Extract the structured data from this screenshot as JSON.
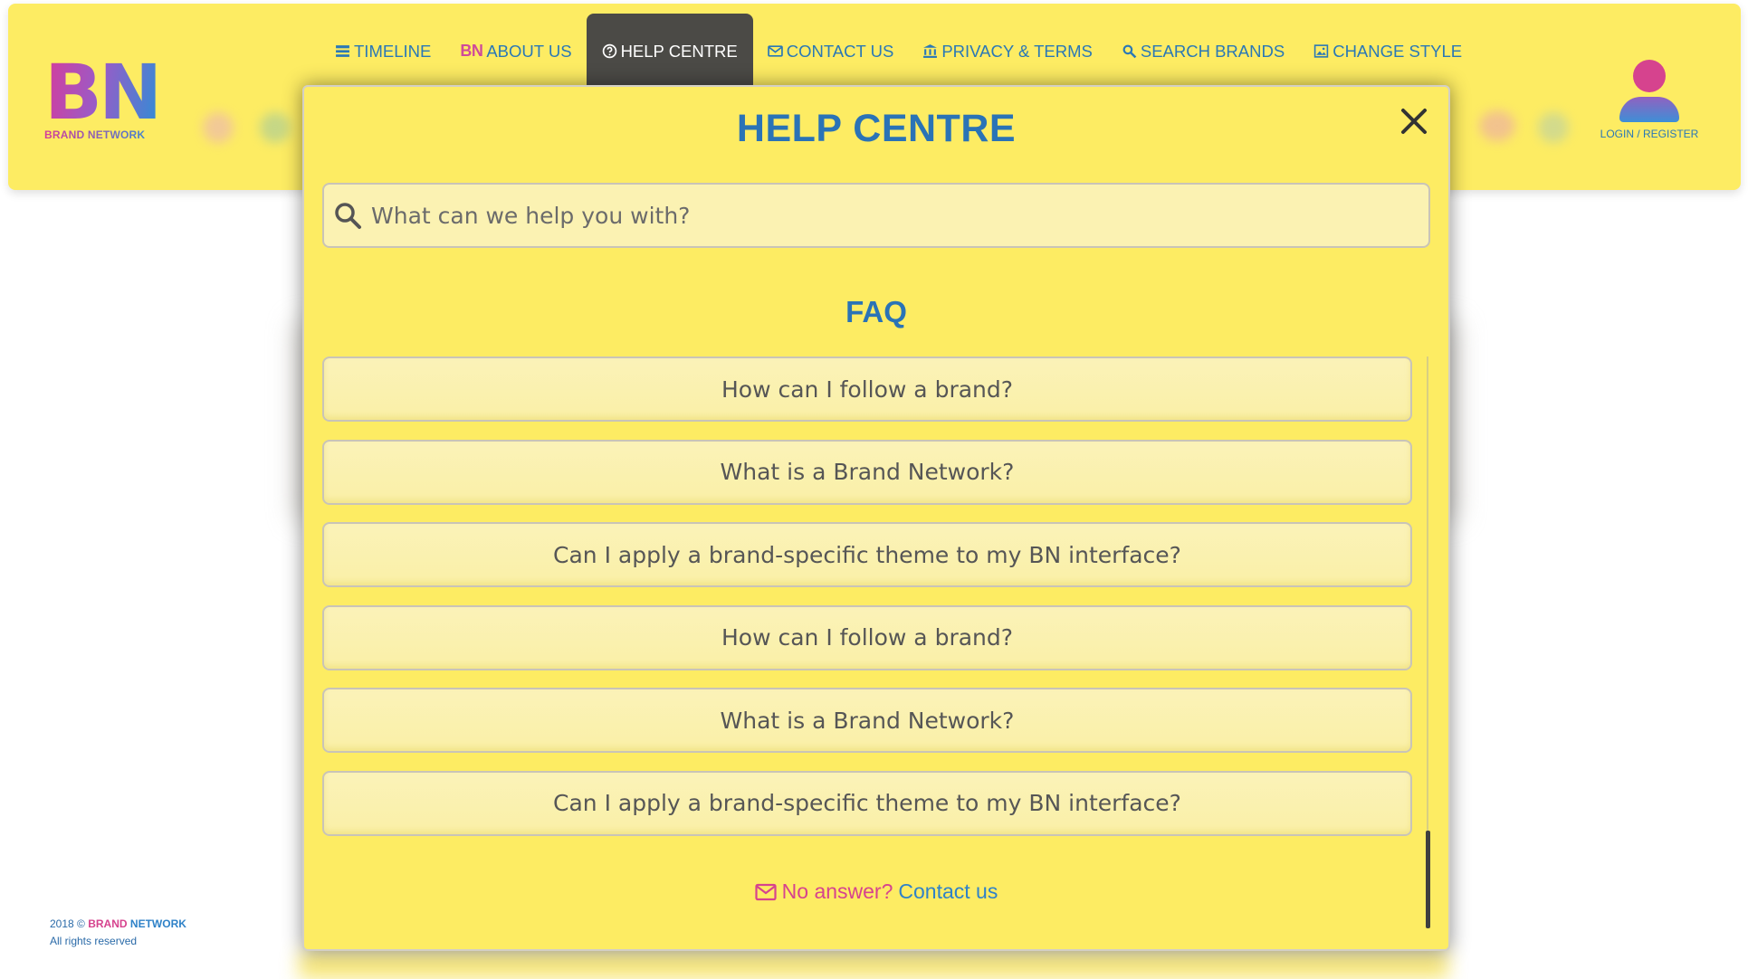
{
  "logo": {
    "mark": "BN",
    "subtitle": "BRAND NETWORK"
  },
  "nav": {
    "items": [
      {
        "label": "TIMELINE",
        "icon": "list-icon"
      },
      {
        "label": "ABOUT US",
        "icon": "bn-logo-icon",
        "glyph": "BN"
      },
      {
        "label": "HELP CENTRE",
        "icon": "help-circle-icon",
        "active": true
      },
      {
        "label": "CONTACT US",
        "icon": "mail-icon"
      },
      {
        "label": "PRIVACY & TERMS",
        "icon": "bank-icon"
      },
      {
        "label": "SEARCH BRANDS",
        "icon": "search-icon"
      },
      {
        "label": "CHANGE STYLE",
        "icon": "image-icon"
      }
    ]
  },
  "user": {
    "label": "LOGIN / REGISTER"
  },
  "footer": {
    "year": "2018 ©",
    "brand_part1": "BRAND",
    "brand_part2": "NETWORK",
    "rights": "All rights reserved"
  },
  "modal": {
    "title": "HELP CENTRE",
    "search_placeholder": "What can we help you with?",
    "faq_title": "FAQ",
    "faq_items": [
      "How can I follow a brand?",
      "What is a Brand Network?",
      "Can I apply a brand-specific theme to my BN interface?",
      "How can I follow a brand?",
      "What is a Brand Network?",
      "Can I apply a brand-specific theme to my BN interface?"
    ],
    "no_answer_text": "No answer?",
    "contact_link": "Contact us"
  },
  "colors": {
    "header_bg": "#fdec63",
    "primary_blue": "#2a73b6",
    "brand_pink": "#d6438e",
    "active_tab_bg": "#4b4a46"
  }
}
